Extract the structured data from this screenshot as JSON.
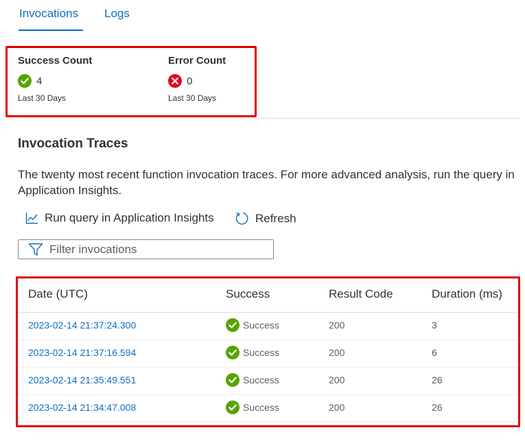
{
  "tabs": [
    {
      "label": "Invocations",
      "active": true
    },
    {
      "label": "Logs",
      "active": false
    }
  ],
  "metrics": {
    "success": {
      "title": "Success Count",
      "value": "4",
      "period": "Last 30 Days",
      "icon": "check-circle-icon",
      "color": "#57a300"
    },
    "error": {
      "title": "Error Count",
      "value": "0",
      "period": "Last 30 Days",
      "icon": "error-circle-icon",
      "color": "#e00b1c"
    }
  },
  "traces": {
    "title": "Invocation Traces",
    "description": "The twenty most recent function invocation traces. For more advanced analysis, run the query in Application Insights.",
    "commands": {
      "run_query": {
        "label": "Run query in Application Insights",
        "icon": "line-chart-icon"
      },
      "refresh": {
        "label": "Refresh",
        "icon": "refresh-icon"
      }
    },
    "filter": {
      "placeholder": "Filter invocations",
      "value": "",
      "icon": "filter-icon"
    },
    "table": {
      "headers": [
        "Date (UTC)",
        "Success",
        "Result Code",
        "Duration (ms)"
      ],
      "rows": [
        {
          "date": "2023-02-14 21:37:24.300",
          "success": "Success",
          "result_code": "200",
          "duration": "3"
        },
        {
          "date": "2023-02-14 21:37:16.594",
          "success": "Success",
          "result_code": "200",
          "duration": "6"
        },
        {
          "date": "2023-02-14 21:35:49.551",
          "success": "Success",
          "result_code": "200",
          "duration": "26"
        },
        {
          "date": "2023-02-14 21:34:47.008",
          "success": "Success",
          "result_code": "200",
          "duration": "26"
        }
      ]
    }
  },
  "colors": {
    "accent": "#0f6cbd",
    "success": "#57a300",
    "error": "#e00b1c",
    "highlight_border": "#e00000"
  }
}
